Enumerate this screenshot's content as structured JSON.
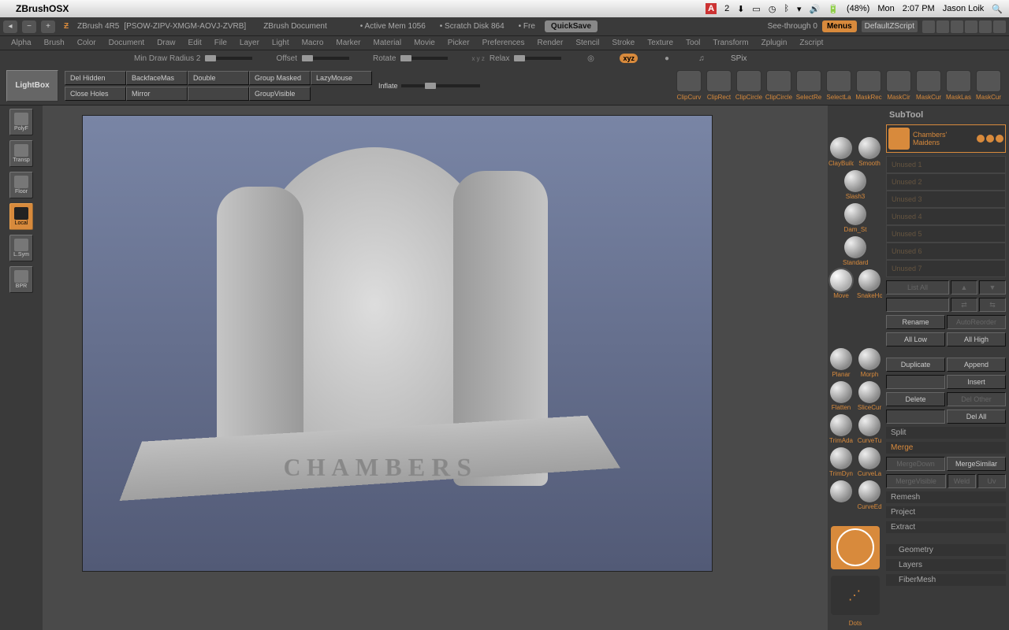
{
  "mac": {
    "app": "ZBrushOSX",
    "adobe": "2",
    "battery": "(48%)",
    "day": "Mon",
    "time": "2:07 PM",
    "user": "Jason Loik"
  },
  "titlebar": {
    "version": "ZBrush 4R5",
    "project": "[PSOW-ZIPV-XMGM-AOVJ-ZVRB]",
    "doc": "ZBrush Document",
    "mem": "• Active Mem 1056",
    "scratch": "• Scratch Disk 864",
    "free": "• Fre",
    "quicksave": "QuickSave",
    "seethrough": "See-through   0",
    "menus": "Menus",
    "zscript": "DefaultZScript"
  },
  "menus": [
    "Alpha",
    "Brush",
    "Color",
    "Document",
    "Draw",
    "Edit",
    "File",
    "Layer",
    "Light",
    "Macro",
    "Marker",
    "Material",
    "Movie",
    "Picker",
    "Preferences",
    "Render",
    "Stencil",
    "Stroke",
    "Texture",
    "Tool",
    "Transform",
    "Zplugin",
    "Zscript"
  ],
  "sliders": {
    "mindraw": "Min Draw Radius 2",
    "offset": "Offset",
    "rotate": "Rotate",
    "relax": "Relax",
    "xyz": "xyz",
    "spix": "SPix"
  },
  "toolbar": {
    "lightbox": "LightBox",
    "row1": [
      "Del Hidden",
      "BackfaceMas",
      "Double",
      "Group Masked",
      "LazyMouse"
    ],
    "row2": [
      "Close Holes",
      "Mirror",
      "",
      "GroupVisible"
    ],
    "inflate": "Inflate",
    "clip": [
      "ClipCurv",
      "ClipRect",
      "ClipCircle",
      "ClipCircle",
      "SelectRe",
      "SelectLa",
      "MaskRec",
      "MaskCir",
      "MaskCur",
      "MaskLas",
      "MaskCur"
    ]
  },
  "dock": [
    "PolyF",
    "Transp",
    "Floor",
    "Local",
    "L.Sym",
    "BPR"
  ],
  "brushes": {
    "pairs": [
      [
        "ClayBuild",
        "Smooth"
      ],
      [
        "Slash3",
        ""
      ],
      [
        "Dam_St",
        ""
      ],
      [
        "Standard",
        ""
      ],
      [
        "Move",
        "SnakeHo"
      ]
    ],
    "lower": [
      [
        "Planar",
        "Morph"
      ],
      [
        "Flatten",
        "SliceCur"
      ],
      [
        "TrimAda",
        "CurveTu"
      ],
      [
        "TrimDyn",
        "CurveLa"
      ],
      [
        "",
        "CurveEd"
      ]
    ],
    "dots": "Dots"
  },
  "panel": {
    "header": "SubTool",
    "subtool_name": "Chambers' Maidens",
    "slots": [
      "Unused 1",
      "Unused 2",
      "Unused 3",
      "Unused 4",
      "Unused 5",
      "Unused 6",
      "Unused 7"
    ],
    "listall": "List All",
    "rename": "Rename",
    "autoreorder": "AutoReorder",
    "alllow": "All Low",
    "allhigh": "All High",
    "duplicate": "Duplicate",
    "append": "Append",
    "insert": "Insert",
    "delete": "Delete",
    "delother": "Del Other",
    "delall": "Del All",
    "split": "Split",
    "merge": "Merge",
    "mergedown": "MergeDown",
    "mergesimilar": "MergeSimilar",
    "mergevisible": "MergeVisible",
    "weld": "Weld",
    "uv": "Uv",
    "remesh": "Remesh",
    "project": "Project",
    "extract": "Extract",
    "geometry": "Geometry",
    "layers": "Layers",
    "fibermesh": "FiberMesh"
  },
  "viewport": {
    "base_text": "CHAMBERS"
  }
}
